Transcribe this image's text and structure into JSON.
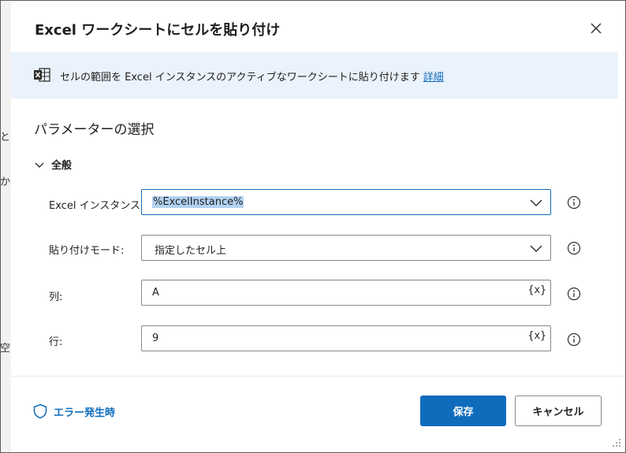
{
  "background": {
    "chars": [
      "と",
      "か",
      "空"
    ]
  },
  "dialog": {
    "title": "Excel ワークシートにセルを貼り付け",
    "close_icon": "close-icon"
  },
  "banner": {
    "icon": "excel-icon",
    "text": "セルの範囲を Excel インスタンスのアクティブなワークシートに貼り付けます",
    "link": "詳細"
  },
  "section": {
    "title": "パラメーターの選択"
  },
  "group": {
    "label": "全般"
  },
  "fields": [
    {
      "label": "Excel インスタンス:",
      "value": "%ExcelInstance%",
      "type": "dropdown"
    },
    {
      "label": "貼り付けモード:",
      "value": "指定したセル上",
      "type": "dropdown"
    },
    {
      "label": "列:",
      "value": "A",
      "type": "text",
      "var_button": "{x}"
    },
    {
      "label": "行:",
      "value": "9",
      "type": "text",
      "var_button": "{x}"
    }
  ],
  "footer": {
    "error_label": "エラー発生時",
    "save_label": "保存",
    "cancel_label": "キャンセル"
  },
  "colors": {
    "accent": "#0f6cbd",
    "banner_bg": "#eaf2fb",
    "selection": "#b3d3f2"
  }
}
